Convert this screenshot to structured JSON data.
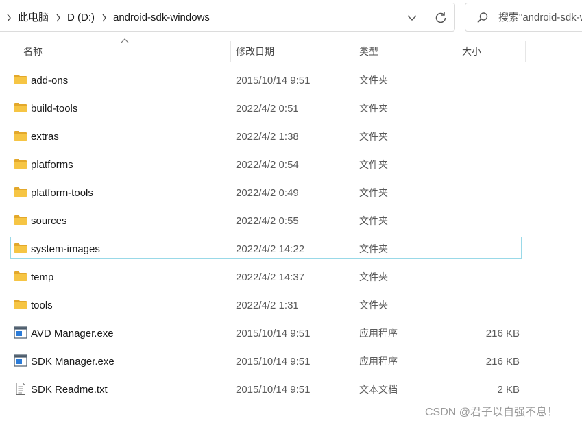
{
  "breadcrumb": {
    "items": [
      "此电脑",
      "D (D:)",
      "android-sdk-windows"
    ]
  },
  "search": {
    "placeholder": "搜索\"android-sdk-windows\""
  },
  "columns": {
    "name": "名称",
    "date": "修改日期",
    "type": "类型",
    "size": "大小"
  },
  "files": [
    {
      "name": "add-ons",
      "date": "2015/10/14 9:51",
      "type": "文件夹",
      "size": "",
      "icon": "folder-icon"
    },
    {
      "name": "build-tools",
      "date": "2022/4/2 0:51",
      "type": "文件夹",
      "size": "",
      "icon": "folder-icon"
    },
    {
      "name": "extras",
      "date": "2022/4/2 1:38",
      "type": "文件夹",
      "size": "",
      "icon": "folder-icon"
    },
    {
      "name": "platforms",
      "date": "2022/4/2 0:54",
      "type": "文件夹",
      "size": "",
      "icon": "folder-icon"
    },
    {
      "name": "platform-tools",
      "date": "2022/4/2 0:49",
      "type": "文件夹",
      "size": "",
      "icon": "folder-icon"
    },
    {
      "name": "sources",
      "date": "2022/4/2 0:55",
      "type": "文件夹",
      "size": "",
      "icon": "folder-icon"
    },
    {
      "name": "system-images",
      "date": "2022/4/2 14:22",
      "type": "文件夹",
      "size": "",
      "icon": "folder-icon",
      "selected": true
    },
    {
      "name": "temp",
      "date": "2022/4/2 14:37",
      "type": "文件夹",
      "size": "",
      "icon": "folder-icon"
    },
    {
      "name": "tools",
      "date": "2022/4/2 1:31",
      "type": "文件夹",
      "size": "",
      "icon": "folder-icon"
    },
    {
      "name": "AVD Manager.exe",
      "date": "2015/10/14 9:51",
      "type": "应用程序",
      "size": "216 KB",
      "icon": "application-icon"
    },
    {
      "name": "SDK Manager.exe",
      "date": "2015/10/14 9:51",
      "type": "应用程序",
      "size": "216 KB",
      "icon": "application-icon"
    },
    {
      "name": "SDK Readme.txt",
      "date": "2015/10/14 9:51",
      "type": "文本文档",
      "size": "2 KB",
      "icon": "text-file-icon"
    }
  ],
  "watermark": "CSDN @君子以自强不息！",
  "colors": {
    "folder": "#f6c544",
    "selection_border": "#99d9e8",
    "application_blue": "#2a7bd8"
  }
}
